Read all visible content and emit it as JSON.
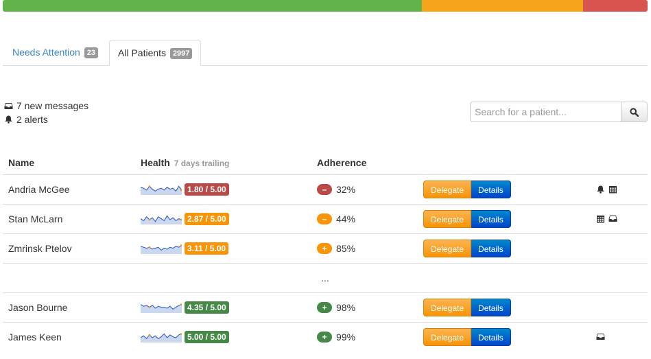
{
  "colors": {
    "progress_green": "#62b44a",
    "progress_orange": "#f5a41c",
    "progress_red": "#d9534f",
    "danger": "#b94a48",
    "warning": "#f89406",
    "success": "#468847",
    "link": "#3a87c8"
  },
  "progress": [
    {
      "name": "good",
      "fraction": 0.65,
      "color": "#62b44a"
    },
    {
      "name": "warning",
      "fraction": 0.25,
      "color": "#f5a41c"
    },
    {
      "name": "critical",
      "fraction": 0.1,
      "color": "#d9534f"
    }
  ],
  "tabs": [
    {
      "label": "Needs Attention",
      "count": "23",
      "active": false
    },
    {
      "label": "All Patients",
      "count": "2997",
      "active": true
    }
  ],
  "summary": {
    "messages": "7 new messages",
    "alerts": "2 alerts",
    "messages_icon": "inbox-icon",
    "alerts_icon": "bell-icon"
  },
  "search": {
    "placeholder": "Search for a patient...",
    "button_icon": "search-icon"
  },
  "table": {
    "headers": {
      "name": "Name",
      "health": "Health",
      "health_sub": "7 days trailing",
      "adherence": "Adherence"
    },
    "delegate_label": "Delegate",
    "details_label": "Details",
    "ellipsis": "...",
    "rows": [
      {
        "name": "Andria McGee",
        "score": "1.80 / 5.00",
        "status": "danger",
        "sign": "–",
        "adherence": "32%",
        "icons": [
          "bell-icon",
          "calendar-icon"
        ]
      },
      {
        "name": "Stan McLarn",
        "score": "2.87 / 5.00",
        "status": "warning",
        "sign": "–",
        "adherence": "44%",
        "icons": [
          "calendar-icon",
          "inbox-icon"
        ]
      },
      {
        "name": "Zmrinsk Ptelov",
        "score": "3.11 / 5.00",
        "status": "warning",
        "sign": "+",
        "adherence": "85%",
        "icons": []
      },
      {
        "name": "Jason Bourne",
        "score": "4.35 / 5.00",
        "status": "success",
        "sign": "+",
        "adherence": "98%",
        "icons": []
      },
      {
        "name": "James Keen",
        "score": "5.00 / 5.00",
        "status": "success",
        "sign": "+",
        "adherence": "99%",
        "icons": [
          "inbox-icon"
        ]
      }
    ]
  }
}
